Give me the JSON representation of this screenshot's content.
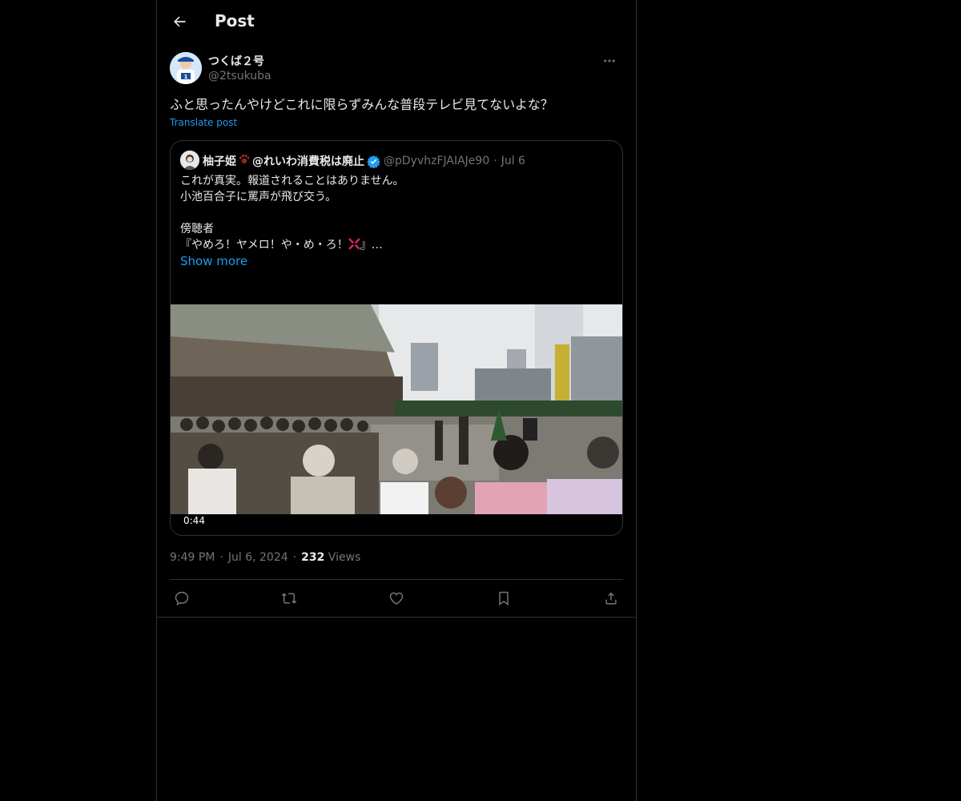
{
  "header": {
    "title": "Post",
    "back_icon": "arrow-left-icon"
  },
  "author": {
    "name": "つくば２号",
    "handle": "@2tsukuba"
  },
  "post": {
    "text": "ふと思ったんやけどこれに限らずみんな普段テレビ見てないよな？",
    "translate_label": "Translate post"
  },
  "quote": {
    "name": "柚子姫",
    "name2": "@れいわ消費税は廃止",
    "handle": "@pDyvhzFJAIAJe90",
    "dot": "·",
    "date": "Jul 6",
    "lines": [
      "これが真実。報道されることはありません。",
      "小池百合子に罵声が飛び交う。",
      "",
      "傍聴者",
      "『やめろ！ヤメロ！や・め・ろ！",
      "』…"
    ],
    "show_more": "Show more",
    "video_duration": "0:44"
  },
  "meta": {
    "time": "9:49 PM",
    "date": "Jul 6, 2024",
    "views_count": "232",
    "views_label": "Views",
    "sep": "·"
  },
  "actions": [
    "reply-icon",
    "repost-icon",
    "like-icon",
    "bookmark-icon",
    "share-icon"
  ],
  "colors": {
    "accent": "#1d9bf0",
    "secondary": "#71767b",
    "border": "#2f3336",
    "background": "#000000"
  }
}
